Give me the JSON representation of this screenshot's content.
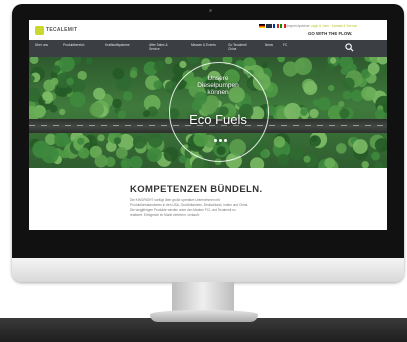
{
  "site": {
    "logo": "TECALEMIT",
    "top_links": {
      "left": "Ansprechpartner",
      "highlight": "Login & Jobs · Kontakt & Service"
    },
    "slogan": "GO WITH THE FLOW."
  },
  "nav": {
    "items": [
      "Über uns",
      "Produktbereich",
      "Kraftstoffsysteme",
      "After Sales & Service",
      "Messen & Events",
      "Go Tecalemit China",
      "News",
      "FC"
    ]
  },
  "hero": {
    "line1": "Unsere",
    "line2": "Dieselpumpen",
    "line3": "können",
    "headline": "Eco Fuels"
  },
  "content": {
    "title": "KOMPETENZEN BÜNDELN.",
    "body": [
      "Die KINGRIGHT sorfügt über große operative Unternehmen mit",
      "Produktionsstandorten in den USA, Großbritannien, Deutschland, Indien und China.",
      "Die langjährigen Produkte werden unter den Marken FCI, und Tecalemit so",
      "realisiert. Erfolgreich im Markt vertreten, verkauft."
    ]
  },
  "colors": {
    "brand": "#c8d82c",
    "nav_bg": "#3b3f43"
  },
  "icons": [
    "search-icon",
    "logo-icon"
  ]
}
